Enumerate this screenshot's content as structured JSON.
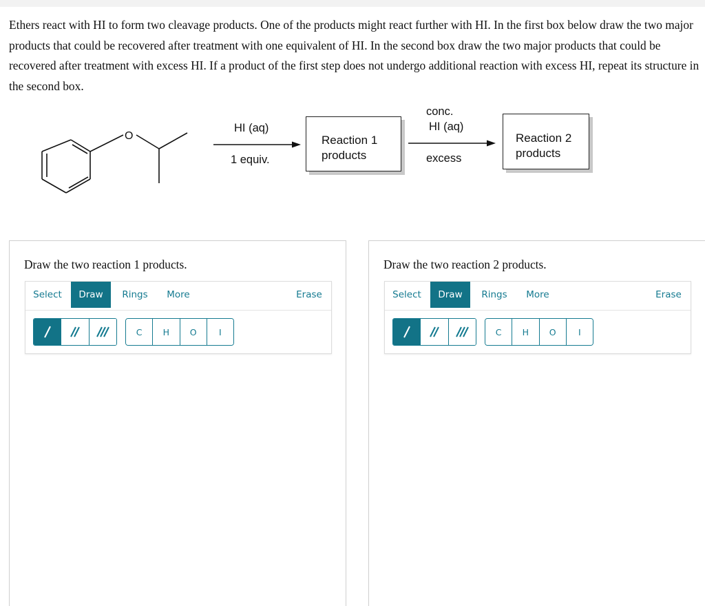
{
  "question": {
    "text": "Ethers react with HI to form two cleavage products. One of the products might react further with HI. In the first box below draw the two major products that could be recovered after treatment with one equivalent of HI. In the second box draw the two major products that could be recovered after treatment with excess HI. If a product of the first step does not undergo additional reaction with excess HI, repeat its structure in the second box."
  },
  "scheme": {
    "reactant": "isopropyl phenyl ether",
    "oxygen_label": "O",
    "arrow1": {
      "above": "HI (aq)",
      "below": "1 equiv."
    },
    "box1": {
      "line1": "Reaction 1",
      "line2": "products"
    },
    "arrow2": {
      "above1": "conc.",
      "above2": "HI (aq)",
      "below": "excess"
    },
    "box2": {
      "line1": "Reaction 2",
      "line2": "products"
    }
  },
  "panels": [
    {
      "title": "Draw the two reaction 1 products.",
      "tabs": [
        "Select",
        "Draw",
        "Rings",
        "More"
      ],
      "active_tab": "Draw",
      "erase_label": "Erase",
      "bond_tools": [
        "single-bond",
        "double-bond",
        "triple-bond"
      ],
      "active_bond": "single-bond",
      "atoms": [
        "C",
        "H",
        "O",
        "I"
      ]
    },
    {
      "title": "Draw the two reaction 2 products.",
      "tabs": [
        "Select",
        "Draw",
        "Rings",
        "More"
      ],
      "active_tab": "Draw",
      "erase_label": "Erase",
      "bond_tools": [
        "single-bond",
        "double-bond",
        "triple-bond"
      ],
      "active_bond": "single-bond",
      "atoms": [
        "C",
        "H",
        "O",
        "I"
      ]
    }
  ],
  "colors": {
    "accent": "#127387",
    "accent_text": "#147a90"
  }
}
